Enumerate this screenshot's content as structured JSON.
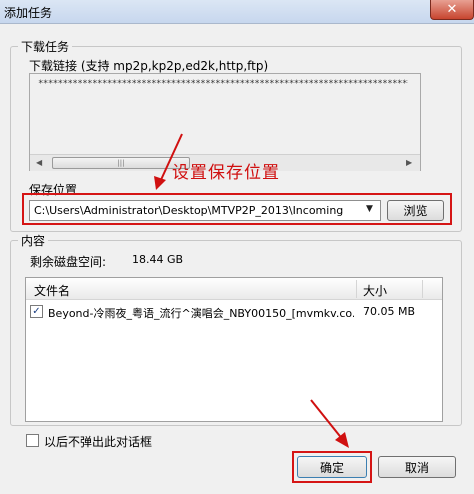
{
  "window": {
    "title": "添加任务",
    "close_glyph": "✕"
  },
  "download_group": {
    "title": "下载任务",
    "link_label": "下载链接 (支持 mp2p,kp2p,ed2k,http,ftp)",
    "link_value": "*****************************************************************************************************************",
    "scroll_left": "◀",
    "scroll_right": "▶",
    "thumb_grip": "|||"
  },
  "annotation": {
    "text": "设置保存位置",
    "color": "#d01010"
  },
  "save_location": {
    "label": "保存位置",
    "path": "C:\\Users\\Administrator\\Desktop\\MTVP2P_2013\\Incoming",
    "dropdown_glyph": "▼",
    "browse_label": "浏览"
  },
  "content_group": {
    "title": "内容",
    "disk_label": "剩余磁盘空间:",
    "disk_value": "18.44 GB",
    "columns": [
      "文件名",
      "大小"
    ],
    "rows": [
      {
        "checked": true,
        "name": "Beyond-冷雨夜_粤语_流行^演唱会_NBY00150_[mvmkv.co...",
        "size": "70.05 MB"
      }
    ],
    "check_glyph": "✓"
  },
  "footer": {
    "dont_show_label": "以后不弹出此对话框",
    "ok_label": "确定",
    "cancel_label": "取消"
  }
}
